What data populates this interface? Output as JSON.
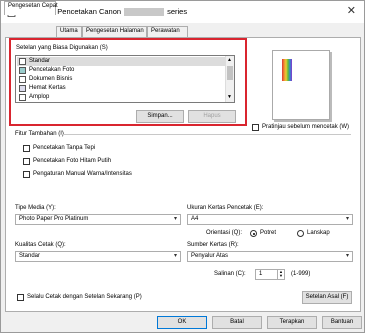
{
  "window": {
    "title_prefix": "Preferensi Pencetakan Canon",
    "title_suffix": "series"
  },
  "tabs": [
    {
      "label": "Pengesetan Cepat"
    },
    {
      "label": "Utama"
    },
    {
      "label": "Pengesetan Halaman"
    },
    {
      "label": "Perawatan"
    }
  ],
  "settings": {
    "group_label": "Setelan yang Biasa Digunakan (S)",
    "items": [
      {
        "label": "Standar"
      },
      {
        "label": "Pencetakan Foto"
      },
      {
        "label": "Dokumen Bisnis"
      },
      {
        "label": "Hemat Kertas"
      },
      {
        "label": "Amplop"
      }
    ],
    "save_label": "Simpan...",
    "delete_label": "Hapus"
  },
  "preview": {
    "label": "Pratinjau sebelum mencetak (W)"
  },
  "additional": {
    "label": "Fitur Tambahan (I)",
    "options": [
      {
        "label": "Pencetakan Tanpa Tepi"
      },
      {
        "label": "Pencetakan Foto Hitam Putih"
      },
      {
        "label": "Pengaturan Manual Warna/Intensitas"
      }
    ]
  },
  "media": {
    "label": "Tipe Media (Y):",
    "value": "Photo Paper Pro Platinum"
  },
  "paper_size": {
    "label": "Ukuran Kertas Pencetak (E):",
    "value": "A4"
  },
  "orientation": {
    "label": "Orientasi (Q):",
    "portrait": "Potret",
    "landscape": "Lanskap"
  },
  "quality": {
    "label": "Kualitas Cetak (Q):",
    "value": "Standar"
  },
  "source": {
    "label": "Sumber Kertas (R):",
    "value": "Penyalur Atas"
  },
  "copies": {
    "label": "Salinan (C):",
    "value": "1",
    "range": "(1-999)"
  },
  "always_print": {
    "label": "Selalu Cetak dengan Setelan Sekarang (P)"
  },
  "defaults_label": "Setelan Asal (F)",
  "footer": {
    "ok": "OK",
    "cancel": "Batal",
    "apply": "Terapkan",
    "help": "Bantuan"
  }
}
